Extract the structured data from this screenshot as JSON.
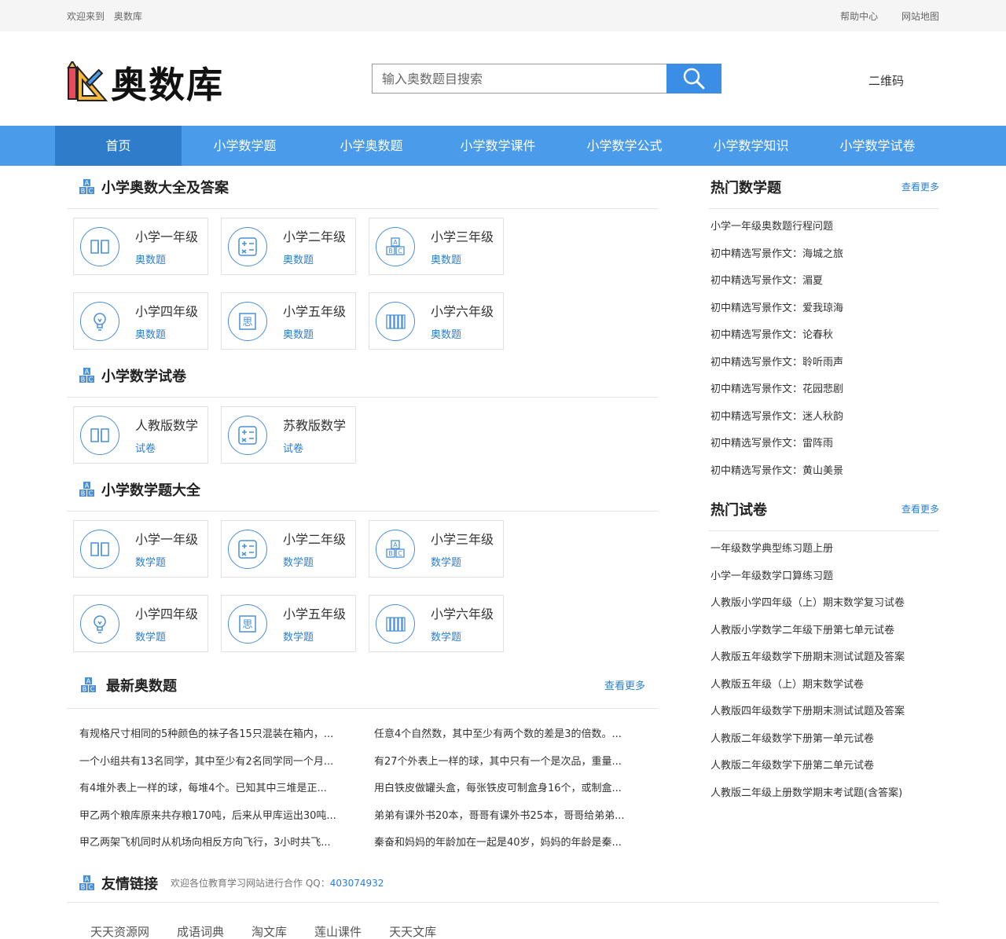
{
  "topbar": {
    "welcome": "欢迎来到",
    "site": "奥数库",
    "help": "帮助中心",
    "sitemap": "网站地图"
  },
  "header": {
    "logo_text": "奥数库",
    "search_placeholder": "输入奥数题目搜索",
    "qrcode": "二维码"
  },
  "nav": [
    "首页",
    "小学数学题",
    "小学奥数题",
    "小学数学课件",
    "小学数学公式",
    "小学数学知识",
    "小学数学试卷"
  ],
  "sections": {
    "olympiad": {
      "title": "小学奥数大全及答案",
      "cards": [
        {
          "t1": "小学一年级",
          "t2": "奥数题",
          "icon": "book-icon"
        },
        {
          "t1": "小学二年级",
          "t2": "奥数题",
          "icon": "calculator-icon"
        },
        {
          "t1": "小学三年级",
          "t2": "奥数题",
          "icon": "abc-blocks-icon"
        },
        {
          "t1": "小学四年级",
          "t2": "奥数题",
          "icon": "lightbulb-icon"
        },
        {
          "t1": "小学五年级",
          "t2": "奥数题",
          "icon": "think-icon"
        },
        {
          "t1": "小学六年级",
          "t2": "奥数题",
          "icon": "books-icon"
        }
      ]
    },
    "papers": {
      "title": "小学数学试卷",
      "cards": [
        {
          "t1": "人教版数学",
          "t2": "试卷",
          "icon": "book-icon"
        },
        {
          "t1": "苏教版数学",
          "t2": "试卷",
          "icon": "calculator-icon"
        }
      ]
    },
    "questions": {
      "title": "小学数学题大全",
      "cards": [
        {
          "t1": "小学一年级",
          "t2": "数学题",
          "icon": "book-icon"
        },
        {
          "t1": "小学二年级",
          "t2": "数学题",
          "icon": "calculator-icon"
        },
        {
          "t1": "小学三年级",
          "t2": "数学题",
          "icon": "abc-blocks-icon"
        },
        {
          "t1": "小学四年级",
          "t2": "数学题",
          "icon": "lightbulb-icon"
        },
        {
          "t1": "小学五年级",
          "t2": "数学题",
          "icon": "think-icon"
        },
        {
          "t1": "小学六年级",
          "t2": "数学题",
          "icon": "books-icon"
        }
      ]
    },
    "latest": {
      "title": "最新奥数题",
      "more": "查看更多",
      "items": [
        "有规格尺寸相同的5种颜色的袜子各15只混装在箱内，...",
        "任意4个自然数，其中至少有两个数的差是3的倍数。...",
        "一个小组共有13名同学，其中至少有2名同学同一个月...",
        "有27个外表上一样的球，其中只有一个是次品，重量...",
        "有4堆外表上一样的球，每堆4个。已知其中三堆是正...",
        "用白铁皮做罐头盒，每张铁皮可制盒身16个，或制盒...",
        "甲乙两个粮库原来共存粮170吨，后来从甲库运出30吨...",
        "弟弟有课外书20本，哥哥有课外书25本，哥哥给弟弟...",
        "甲乙两架飞机同时从机场向相反方向飞行，3小时共飞...",
        "秦奋和妈妈的年龄加在一起是40岁，妈妈的年龄是秦..."
      ]
    },
    "friends": {
      "title": "友情链接",
      "note": "欢迎各位教育学习网站进行合作 QQ：",
      "qq": "403074932",
      "links": [
        "天天资源网",
        "成语词典",
        "淘文库",
        "莲山课件",
        "天天文库"
      ]
    }
  },
  "sidebar": {
    "hot_questions": {
      "title": "热门数学题",
      "more": "查看更多",
      "items": [
        "小学一年级奥数题行程问题",
        "初中精选写景作文：海城之旅",
        "初中精选写景作文：湄夏",
        "初中精选写景作文：爱我琼海",
        "初中精选写景作文：论春秋",
        "初中精选写景作文：聆听雨声",
        "初中精选写景作文：花园悲剧",
        "初中精选写景作文：迷人秋韵",
        "初中精选写景作文：雷阵雨",
        "初中精选写景作文：黄山美景"
      ]
    },
    "hot_papers": {
      "title": "热门试卷",
      "more": "查看更多",
      "items": [
        "一年级数学典型练习题上册",
        "小学一年级数学口算练习题",
        "人教版小学四年级（上）期末数学复习试卷",
        "人教版小学数学二年级下册第七单元试卷",
        "人教版五年级数学下册期末测试试题及答案",
        "人教版五年级（上）期末数学试卷",
        "人教版四年级数学下册期末测试试题及答案",
        "人教版二年级数学下册第一单元试卷",
        "人教版二年级数学下册第二单元试卷",
        "人教版二年级上册数学期末考试题(含答案)"
      ]
    }
  },
  "colors": {
    "accent": "#4a9be9",
    "nav_active": "#2f7ccb",
    "link": "#2a7fd4"
  }
}
